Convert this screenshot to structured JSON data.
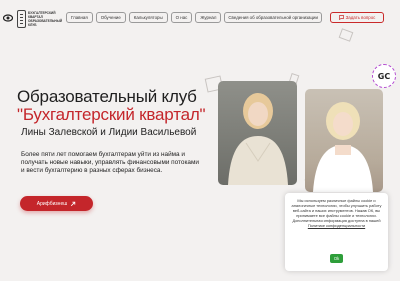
{
  "header": {
    "logo_text": [
      "БУХГАЛТЕРСКИЙ",
      "КВАРТАЛ",
      "ОБРАЗОВАТЕЛЬНЫЙ",
      "КЛУБ"
    ],
    "nav": [
      "Главная",
      "Обучение",
      "Калькуляторы",
      "О нас",
      "Журнал",
      "Сведения об образовательной организации"
    ],
    "ask_button": "Задать вопрос"
  },
  "badge": {
    "label": "GC"
  },
  "hero": {
    "title": "Образовательный клуб",
    "title_accent": "\"Бухгалтерский квартал\"",
    "subtitle": "Лины Залевской и Лидии Васильевой",
    "description": "Более пяти лет помогаем бухгалтерам уйти из найма и получать новые навыки, управлять финансовыми потоками и вести бухгалтерию в разных сферах бизнеса.",
    "cta_label": "Арифбизнеш"
  },
  "cookie": {
    "text": "Мы используем различные файлы cookie и аналогичные технологии, чтобы улучшить работу веб-сайта и наших инструментов. Нажав ОК, вы принимаете все файлы cookie и технологии. Дополнительная информация доступна в нашей",
    "link": "Политике конфиденциальности",
    "ok_label": "Ok"
  },
  "colors": {
    "accent": "#c4262b",
    "background": "#f3f1f0",
    "ok": "#2e9e3a"
  }
}
